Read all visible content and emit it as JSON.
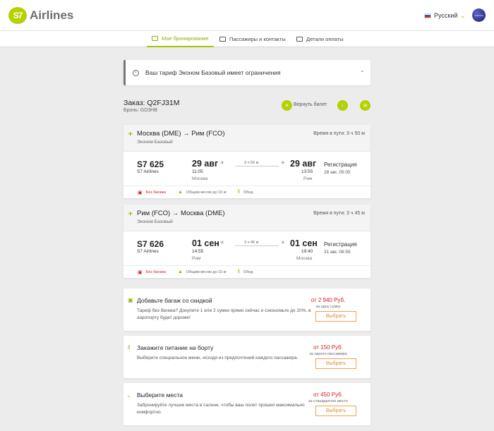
{
  "header": {
    "logo_mark": "S7",
    "logo_text": "Airlines",
    "language": "Русский",
    "avatar_label": "oneworld"
  },
  "nav": {
    "tabs": [
      {
        "label": "Мое бронирование"
      },
      {
        "label": "Пассажиры и контакты"
      },
      {
        "label": "Детали оплаты"
      }
    ]
  },
  "notice": {
    "text": "Ваш тариф Эконом Базовый имеет ограничения"
  },
  "order": {
    "title": "Заказ: Q2FJ31M",
    "booking": "Бронь: GD3HB",
    "refund_label": "Вернуть билет"
  },
  "flights": [
    {
      "route": "Москва (DME) → Рим (FCO)",
      "class": "Эконом Базовый",
      "travel_time": "Время в пути: 3 ч 50 м",
      "number": "S7 625",
      "airline": "S7 Airlines",
      "dep_date": "29 авг",
      "dep_time": "11:05",
      "dep_city": "Москва",
      "duration": "3 ч 50 м",
      "arr_date": "29 авг",
      "arr_time": "13:55",
      "arr_city": "Рим",
      "reg_label": "Регистрация",
      "reg_datetime": "28 авг, 05:05",
      "features": [
        "Без багажа",
        "Общим весом до 10 кг",
        "Обед"
      ]
    },
    {
      "route": "Рим (FCO) → Москва (DME)",
      "class": "Эконом Базовый",
      "travel_time": "Время в пути: 3 ч 45 м",
      "number": "S7 626",
      "airline": "S7 Airlines",
      "dep_date": "01 сен",
      "dep_time": "14:55",
      "dep_city": "Рим",
      "duration": "3 ч 45 м",
      "arr_date": "01 сен",
      "arr_time": "19:40",
      "arr_city": "Москва",
      "reg_label": "Регистрация",
      "reg_datetime": "31 авг, 08:55",
      "features": [
        "Без багажа",
        "Общим весом до 10 кг",
        "Обед"
      ]
    }
  ],
  "offers": [
    {
      "title": "Добавьте багаж со скидкой",
      "desc": "Тариф без багажа? Докупите 1 или 2 сумки прямо сейчас и сэкономьте до 20%, в аэропорту будет дороже!",
      "price": "от 2 940 Руб.",
      "per": "за одну сумку",
      "button": "Выбрать"
    },
    {
      "title": "Закажите питание на борту",
      "desc": "Выберите специальное меню, исходя из предпочтений каждого пассажира.",
      "price": "от 150 Руб.",
      "per": "за одного пассажира",
      "button": "Выбрать"
    },
    {
      "title": "Выберите места",
      "desc": "Забронируйте лучшие места в салоне, чтобы ваш полет прошел максимально комфортно.",
      "price": "от 450 Руб.",
      "per": "за стандартное место",
      "button": "Выбрать"
    }
  ],
  "colors": {
    "accent": "#b5d100",
    "price": "#d0202a",
    "button": "#e08a30"
  }
}
